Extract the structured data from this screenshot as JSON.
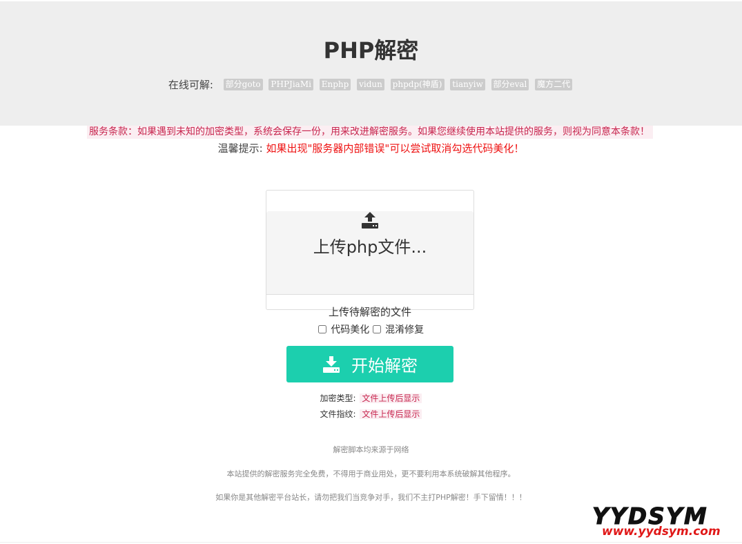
{
  "header": {
    "title": "PHP解密",
    "online_label": "在线可解:",
    "badges": [
      "部分goto",
      "PHPJiaMi",
      "Enphp",
      "vidun",
      "phpdp(神盾)",
      "tianyiw",
      "部分eval",
      "魔方二代"
    ]
  },
  "notices": {
    "terms": "服务条款：如果遇到未知的加密类型，系统会保存一份，用来改进解密服务。如果您继续使用本站提供的服务，则视为同意本条款！",
    "tip_label": "温馨提示:",
    "tip_text": "如果出现\"服务器内部错误\"可以尝试取消勾选代码美化！"
  },
  "upload": {
    "icon": "upload-icon",
    "title": "上传php文件...",
    "subtitle": "上传待解密的文件"
  },
  "options": {
    "beautify_label": "代码美化",
    "beautify_checked": false,
    "obfuscation_label": "混淆修复",
    "obfuscation_checked": false
  },
  "start_button": {
    "icon": "download-icon",
    "label": "开始解密"
  },
  "result": {
    "type_label": "加密类型:",
    "type_value": "文件上传后显示",
    "fingerprint_label": "文件指纹:",
    "fingerprint_value": "文件上传后显示"
  },
  "footer": {
    "line1": "解密脚本均来源于网络",
    "line2": "本站提供的解密服务完全免费，不得用于商业用处，更不要利用本系统破解其他程序。",
    "line3": "如果你是其他解密平台站长，请勿把我们当竞争对手，我们不主打PHP解密！手下留情！！！"
  },
  "watermark": {
    "brand": "YYDSYM",
    "url": "www.yydsym.com"
  },
  "colors": {
    "accent": "#1ccfae",
    "badge_bg": "#cccccc",
    "hero_bg": "#eeeeee",
    "code_red": "#c7254e",
    "warning_red": "#ee1111"
  }
}
